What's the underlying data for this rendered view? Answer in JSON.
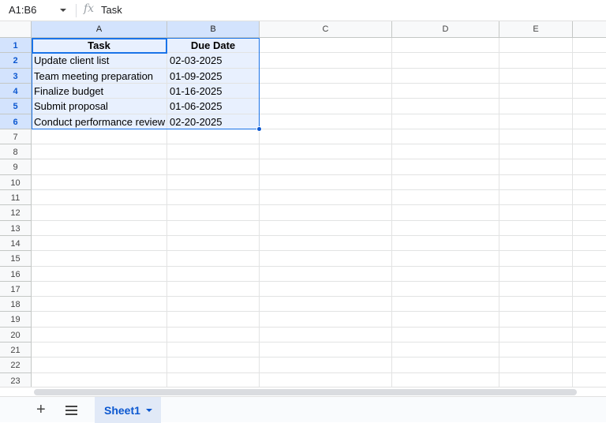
{
  "formula_bar": {
    "name_box": "A1:B6",
    "fx_icon": "fx",
    "value": "Task"
  },
  "columns": [
    "A",
    "B",
    "C",
    "D",
    "E",
    ""
  ],
  "row_numbers": [
    "1",
    "2",
    "3",
    "4",
    "5",
    "6",
    "7",
    "8",
    "9",
    "10",
    "11",
    "12",
    "13",
    "14",
    "15",
    "16",
    "17",
    "18",
    "19",
    "20",
    "21",
    "22",
    "23"
  ],
  "cells": [
    [
      "Task",
      "Due Date"
    ],
    [
      "Update client list",
      "02-03-2025"
    ],
    [
      "Team meeting preparation",
      "01-09-2025"
    ],
    [
      "Finalize budget",
      "01-16-2025"
    ],
    [
      "Submit proposal",
      "01-06-2025"
    ],
    [
      "Conduct performance review",
      "02-20-2025"
    ]
  ],
  "sheet_tabs": [
    {
      "label": "Sheet1",
      "active": true
    }
  ],
  "bottom": {
    "add_icon": "+"
  },
  "colors": {
    "accent": "#0b57d0",
    "selection": "#e8f0fe",
    "header_selected": "#d3e3fd"
  }
}
